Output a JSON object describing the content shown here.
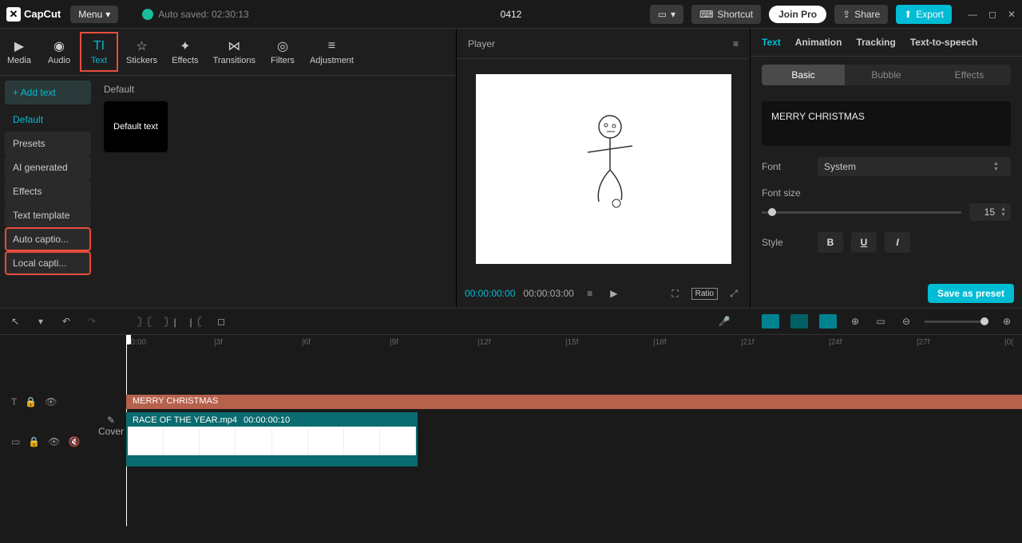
{
  "topbar": {
    "logo": "CapCut",
    "menu": "Menu",
    "autosave": "Auto saved: 02:30:13",
    "project": "0412",
    "shortcut": "Shortcut",
    "join_pro": "Join Pro",
    "share": "Share",
    "export": "Export"
  },
  "toolTabs": [
    {
      "label": "Media",
      "icon": "▶"
    },
    {
      "label": "Audio",
      "icon": "◉"
    },
    {
      "label": "Text",
      "icon": "TI",
      "active": true,
      "highlighted": true
    },
    {
      "label": "Stickers",
      "icon": "☆"
    },
    {
      "label": "Effects",
      "icon": "✦"
    },
    {
      "label": "Transitions",
      "icon": "⋈"
    },
    {
      "label": "Filters",
      "icon": "◎"
    },
    {
      "label": "Adjustment",
      "icon": "≡"
    }
  ],
  "sidebar": {
    "addText": "+ Add text",
    "items": [
      {
        "label": "Default",
        "activeSub": true
      },
      {
        "label": "Presets"
      },
      {
        "label": "AI generated"
      },
      {
        "label": "Effects"
      },
      {
        "label": "Text template"
      },
      {
        "label": "Auto captio...",
        "highlighted": true
      },
      {
        "label": "Local capti...",
        "highlighted": true
      }
    ]
  },
  "content": {
    "sectionTitle": "Default",
    "thumbLabel": "Default text"
  },
  "player": {
    "title": "Player",
    "current": "00:00:00:00",
    "total": "00:00:03:00",
    "ratio": "Ratio"
  },
  "inspector": {
    "tabs": [
      "Text",
      "Animation",
      "Tracking",
      "Text-to-speech"
    ],
    "subtabs": [
      "Basic",
      "Bubble",
      "Effects"
    ],
    "textValue": "MERRY CHRISTMAS",
    "fontLabel": "Font",
    "fontValue": "System",
    "fontSizeLabel": "Font size",
    "fontSizeValue": "15",
    "styleLabel": "Style",
    "savePreset": "Save as preset"
  },
  "ruler": [
    "00:00",
    "|3f",
    "|6f",
    "|9f",
    "|12f",
    "|15f",
    "|18f",
    "|21f",
    "|24f",
    "|27f",
    "|0("
  ],
  "timeline": {
    "cover": "Cover",
    "textClip": "MERRY CHRISTMAS",
    "videoClipName": "RACE OF THE YEAR.mp4",
    "videoClipTime": "00:00:00:10"
  }
}
